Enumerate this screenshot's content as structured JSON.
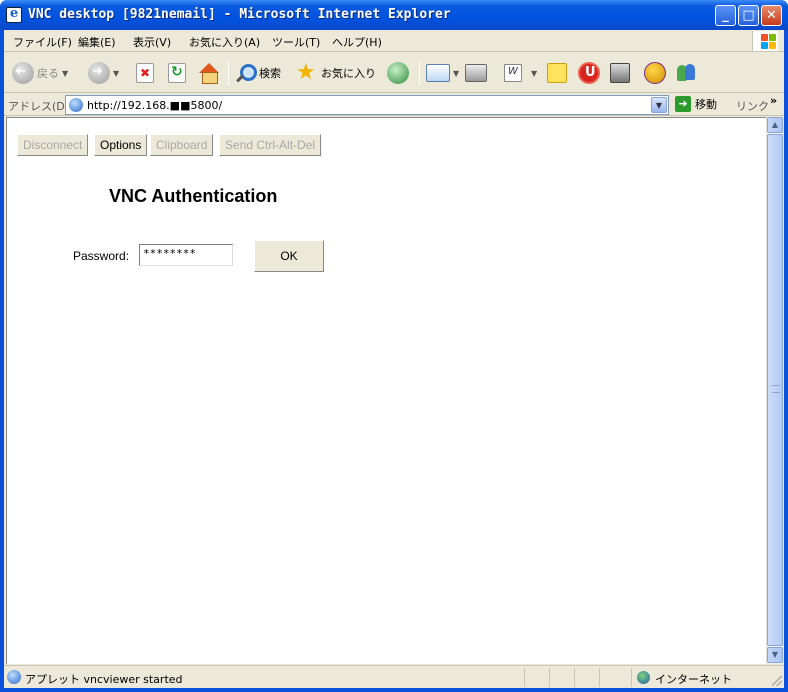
{
  "window": {
    "title": "VNC desktop [9821nemail] - Microsoft Internet Explorer",
    "controls": {
      "minimize": "_",
      "maximize": "□",
      "close": "✕"
    }
  },
  "menu": [
    "ファイル(F)",
    "編集(E)",
    "表示(V)",
    "お気に入り(A)",
    "ツール(T)",
    "ヘルプ(H)"
  ],
  "toolbar": {
    "back_label": "戻る",
    "search_label": "検索",
    "favorites_label": "お気に入り"
  },
  "address": {
    "label": "アドレス(D)",
    "url": "http://192.168.■■5800/",
    "go_label": "移動",
    "links_label": "リンク",
    "more": "»"
  },
  "vnc": {
    "buttons": [
      {
        "label": "Disconnect",
        "enabled": false
      },
      {
        "label": "Options",
        "enabled": true
      },
      {
        "label": "Clipboard",
        "enabled": false
      },
      {
        "label": "Send Ctrl-Alt-Del",
        "enabled": false
      }
    ],
    "heading": "VNC Authentication",
    "password_label": "Password:",
    "password_value": "********",
    "ok_label": "OK"
  },
  "statusbar": {
    "text": "アプレット vncviewer started",
    "zone": "インターネット"
  },
  "colors": {
    "titlebar": "#0053e0",
    "chrome": "#ece9d8",
    "content": "#ffffff"
  }
}
